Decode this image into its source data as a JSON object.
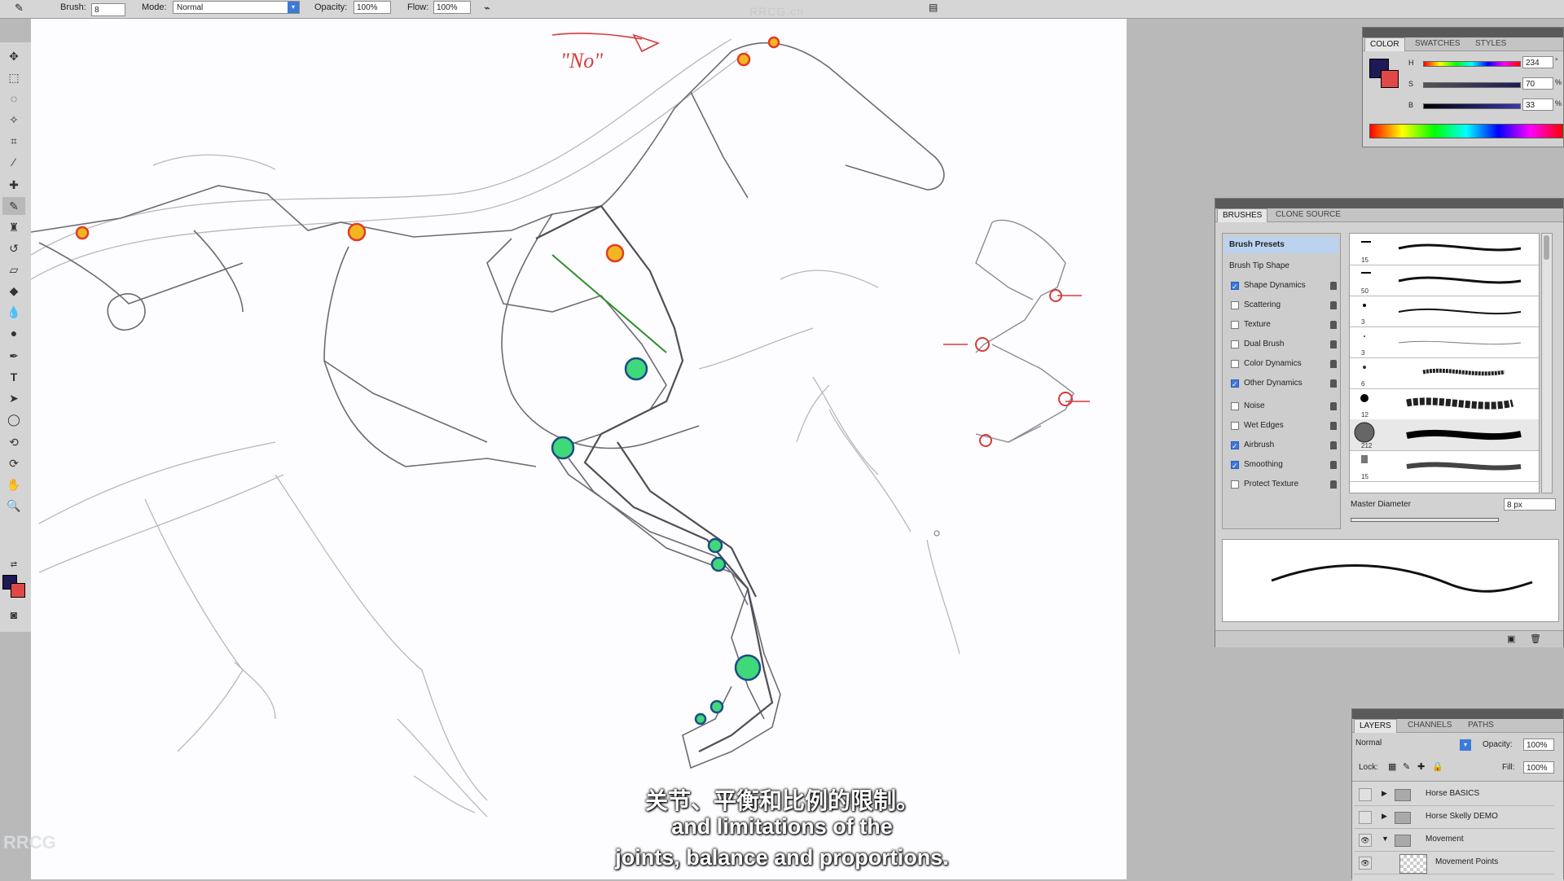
{
  "options_bar": {
    "brush_label": "Brush:",
    "brush_size": "8",
    "mode_label": "Mode:",
    "mode_value": "Normal",
    "opacity_label": "Opacity:",
    "opacity_value": "100%",
    "flow_label": "Flow:",
    "flow_value": "100%"
  },
  "watermark_top": "RRCG.cn",
  "canvas": {
    "annotation_no": "\"No\""
  },
  "color_panel": {
    "tabs": [
      "COLOR",
      "SWATCHES",
      "STYLES"
    ],
    "h_label": "H",
    "h_value": "234",
    "h_unit": "°",
    "s_label": "S",
    "s_value": "70",
    "s_unit": "%",
    "b_label": "B",
    "b_value": "33",
    "b_unit": "%",
    "foreground_color": "#1d1a55",
    "background_color": "#e04848"
  },
  "brushes_panel": {
    "tabs": [
      "BRUSHES",
      "CLONE SOURCE"
    ],
    "items": [
      {
        "label": "Brush Presets",
        "checkbox": false,
        "selected": true
      },
      {
        "label": "Brush Tip Shape",
        "checkbox": false
      },
      {
        "label": "Shape Dynamics",
        "checkbox": true,
        "checked": true
      },
      {
        "label": "Scattering",
        "checkbox": true,
        "checked": false
      },
      {
        "label": "Texture",
        "checkbox": true,
        "checked": false
      },
      {
        "label": "Dual Brush",
        "checkbox": true,
        "checked": false
      },
      {
        "label": "Color Dynamics",
        "checkbox": true,
        "checked": false
      },
      {
        "label": "Other Dynamics",
        "checkbox": true,
        "checked": true
      },
      {
        "label": "Noise",
        "checkbox": true,
        "checked": false
      },
      {
        "label": "Wet Edges",
        "checkbox": true,
        "checked": false
      },
      {
        "label": "Airbrush",
        "checkbox": true,
        "checked": true
      },
      {
        "label": "Smoothing",
        "checkbox": true,
        "checked": true
      },
      {
        "label": "Protect Texture",
        "checkbox": true,
        "checked": false
      }
    ],
    "brush_sizes": [
      "15",
      "50",
      "3",
      "3",
      "6",
      "12",
      "212",
      "15"
    ],
    "master_diameter_label": "Master Diameter",
    "master_diameter_value": "8 px"
  },
  "layers_panel": {
    "tabs": [
      "LAYERS",
      "CHANNELS",
      "PATHS"
    ],
    "blend_mode": "Normal",
    "opacity_label": "Opacity:",
    "opacity_value": "100%",
    "lock_label": "Lock:",
    "fill_label": "Fill:",
    "fill_value": "100%",
    "layers": [
      {
        "name": "Horse BASICS",
        "expanded": false,
        "visible": false
      },
      {
        "name": "Horse Skelly DEMO",
        "expanded": false,
        "visible": false
      },
      {
        "name": "Movement",
        "expanded": true,
        "visible": true
      },
      {
        "name": "Movement Points",
        "expanded": false,
        "visible": true
      }
    ]
  },
  "subtitles": {
    "chinese": "关节、平衡和比例的限制。",
    "english_line1": "and limitations of the",
    "english_line2": "joints, balance and proportions."
  },
  "logo_text": "RRCG"
}
